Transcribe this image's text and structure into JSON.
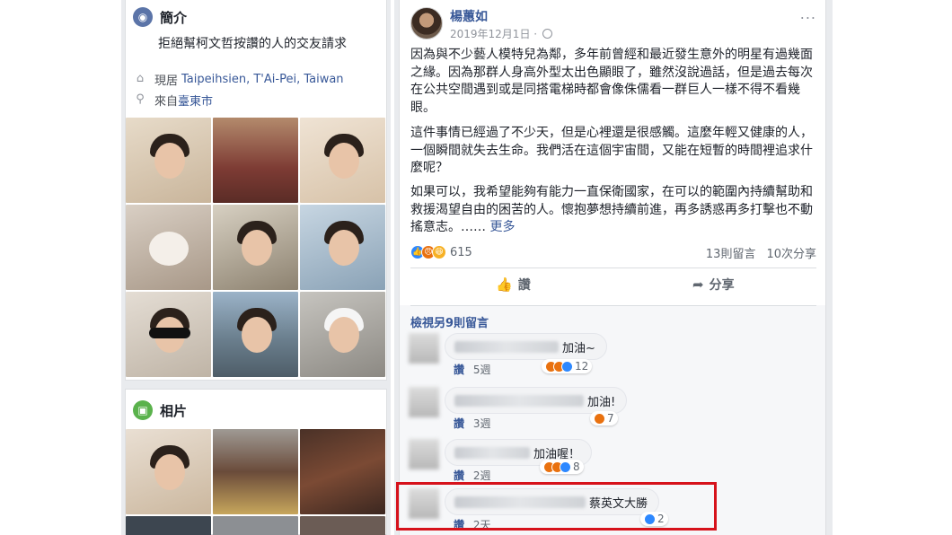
{
  "intro": {
    "title": "簡介",
    "bio": "拒絕幫柯文哲按讚的人的交友請求",
    "lives_prefix": "現居",
    "lives_city": "Taipeihsien, T'Ai-Pei, Taiwan",
    "from_prefix": "來自",
    "from_city": "臺東市"
  },
  "photos": {
    "title": "相片"
  },
  "post": {
    "author": "楊蕙如",
    "date": "2019年12月1日 · ",
    "more_icon": "...",
    "paragraph1": "因為與不少藝人模特兒為鄰，多年前曾經和最近發生意外的明星有過幾面之緣。因為那群人身高外型太出色顯眼了，雖然沒說過話，但是過去每次在公共空間遇到或是同搭電梯時都會像侏儒看一群巨人一樣不得不看幾眼。",
    "paragraph2": "這件事情已經過了不少天，但是心裡還是很感觸。這麼年輕又健康的人，一個瞬間就失去生命。我們活在這個宇宙間，又能在短暫的時間裡追求什麼呢？",
    "paragraph3": "如果可以，我希望能夠有能力一直保衛國家，在可以的範圍內持續幫助和救援渴望自由的困苦的人。懷抱夢想持續前進，再多誘惑再多打擊也不動搖意志。……",
    "see_more": "更多",
    "reaction_count": "615",
    "comment_count": "13則留言",
    "share_count": "10次分享",
    "like_button": "讚",
    "share_button": "分享"
  },
  "comments": {
    "view_more": "檢視另9則留言",
    "items": [
      {
        "text": "加油~",
        "like": "讚",
        "time": "5週",
        "count": "12"
      },
      {
        "text": "加油!",
        "like": "讚",
        "time": "3週",
        "count": "7"
      },
      {
        "text": "加油喔！",
        "like": "讚",
        "time": "2週",
        "count": "8"
      },
      {
        "text": "蔡英文大勝",
        "like": "讚",
        "time": "2天",
        "count": "2"
      }
    ]
  },
  "colors": {
    "link": "#385898",
    "highlight_box": "#d6121b",
    "like_blue": "#2d88ff",
    "angry_orange": "#e9710f",
    "haha_yellow": "#f7b125"
  }
}
